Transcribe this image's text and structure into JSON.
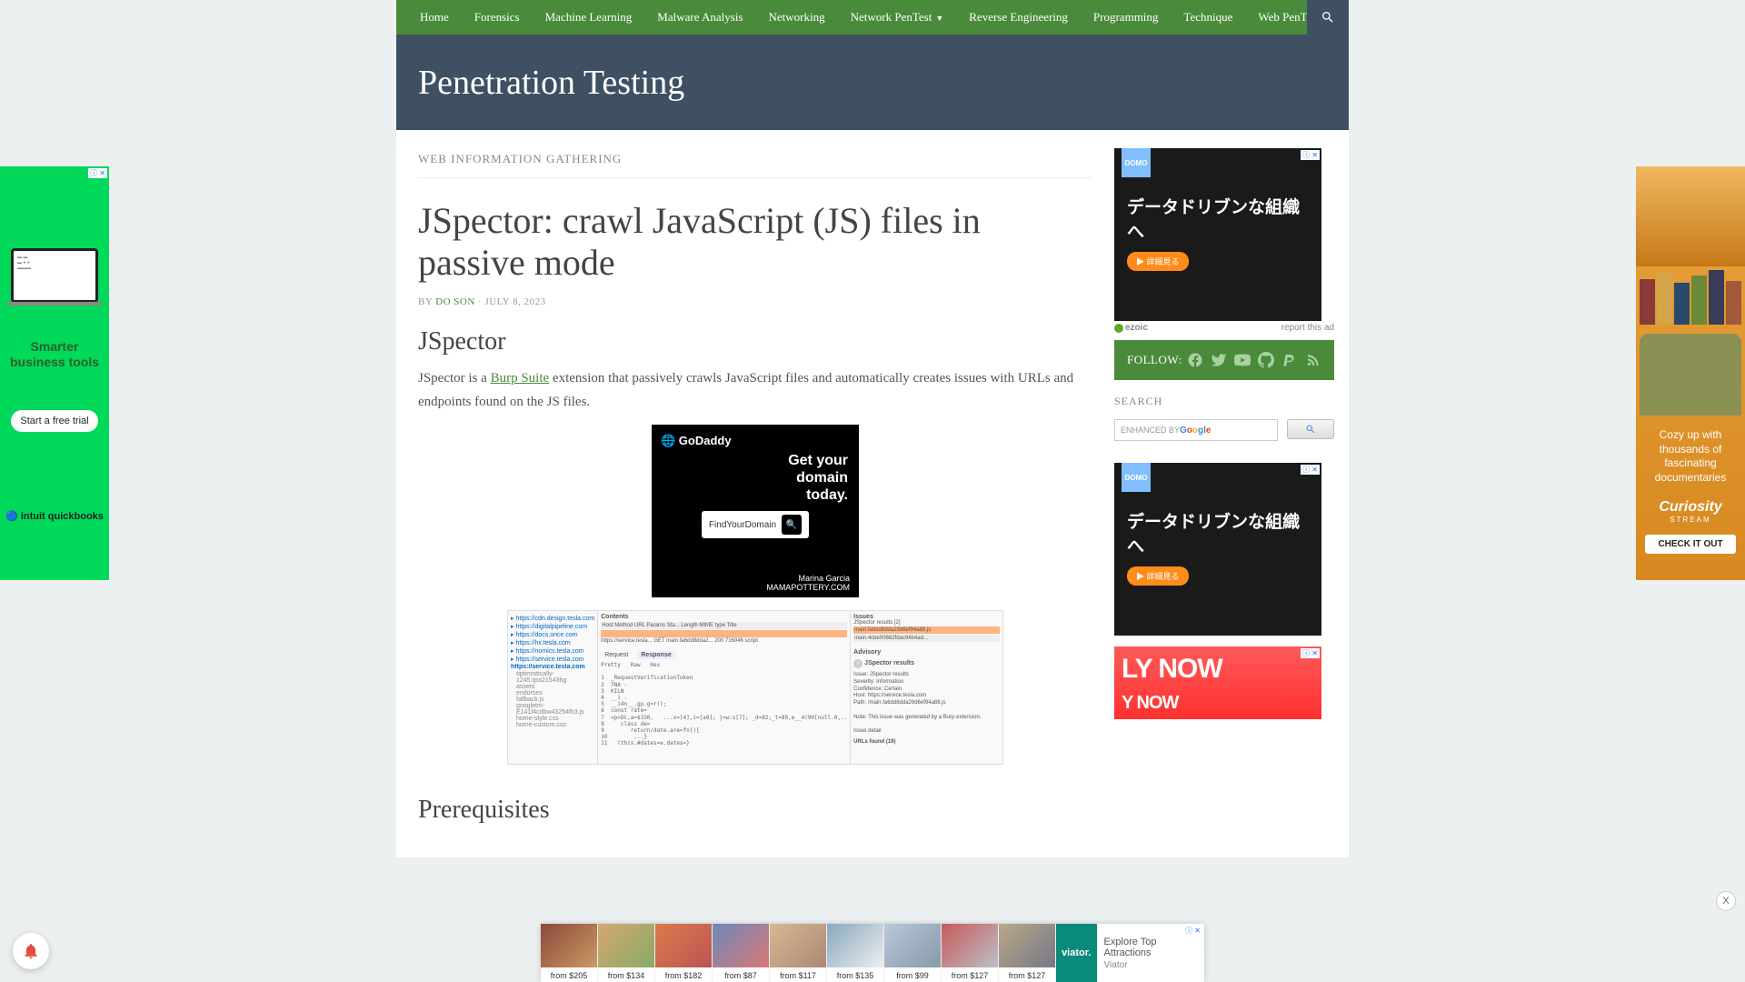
{
  "nav": {
    "items": [
      {
        "label": "Home",
        "dropdown": false
      },
      {
        "label": "Forensics",
        "dropdown": false
      },
      {
        "label": "Machine Learning",
        "dropdown": false
      },
      {
        "label": "Malware Analysis",
        "dropdown": false
      },
      {
        "label": "Networking",
        "dropdown": false
      },
      {
        "label": "Network PenTest",
        "dropdown": true
      },
      {
        "label": "Reverse Engineering",
        "dropdown": false
      },
      {
        "label": "Programming",
        "dropdown": false
      },
      {
        "label": "Technique",
        "dropdown": false
      },
      {
        "label": "Web PenTest",
        "dropdown": true
      }
    ]
  },
  "site_title": "Penetration Testing",
  "category": "WEB INFORMATION GATHERING",
  "article": {
    "title": "JSpector: crawl JavaScript (JS) files in passive mode",
    "by": "BY ",
    "author": "DO SON",
    "sep": " · ",
    "date": "JULY 8, 2023",
    "section": "JSpector",
    "p1_a": "JSpector is a ",
    "p1_link": "Burp Suite",
    "p1_b": " extension that passively crawls JavaScript files and automatically creates issues with URLs and endpoints found on the JS files.",
    "section2": "Prerequisites"
  },
  "ad_center": {
    "brand": "🌐 GoDaddy",
    "headline": "Get your domain today.",
    "placeholder": "FindYourDomain",
    "name1": "Marina Garcia",
    "name2": "MAMAPOTTERY.COM"
  },
  "screenshot": {
    "urls": [
      "https://cdn.design.tesla.com",
      "https://digitalpipeline.com",
      "https://docs.once.com",
      "https://hx.tesla.com",
      "https://nomics.tesla.com",
      "https://service.tesla.com"
    ],
    "last_url": "https://service.tesla.com",
    "tree": [
      "optimistically-1245.tjss21543hg",
      "assets",
      "endorses",
      "fallback.js",
      "googletm-E141f4cdbw43254fh3.js",
      "home-style.css",
      "home-custom.css"
    ],
    "contents_hdr": "Contents",
    "cols": "Host      Method    URL      Params   Sta...   Length   MIME type    Title",
    "row": "https://service.tesla... GET   main.fa6dd8dda2...        200   716046  script",
    "tabs": [
      "Request",
      "Response"
    ],
    "code": "Pretty   Raw   Hex\n\n1  _RequestVerificationToken\n2  TNA -\n3  KILN\n4  __i -\n5  __i4n__.gp.g=r();\n6  const rate=\n7  <p>DC,a=$330,   ...x=[4],i=[a9]; j=w:s[7]; _d=82;_t=89,e__4(90[null.0,..\n8     class de=\n9        return/date.are=fn(){\n10        ...}\n11   (this.#dates=e.dates=}",
    "issues_hdr": "Issues",
    "issue_rows": [
      "JSpector results [2]",
      "main.fa6dd8dda29d6ef94a88.js",
      "main.4cbe00662fdac94b4ad..."
    ],
    "advisory": "Advisory",
    "result_title": "JSpector results",
    "details": "Issue:         JSpector results\nSeverity:    Information\nConfidence: Certain\nHost:          https://service.tesla.com\nPath:          /main.fa6dd8dda29d6ef94a88.js\n\nNote: This issue was generated by a Burp extension.\n\nIssue detail",
    "urls_found": "URLs found (19)"
  },
  "ezoic": {
    "brand": "ezoic",
    "report": "report this ad"
  },
  "follow": {
    "label": "FOLLOW:"
  },
  "search": {
    "header": "SEARCH",
    "placeholder": "ENHANCED BY Google"
  },
  "ad_side": {
    "logo": "DOMO",
    "jp": "データドリブンな組織へ",
    "btn": "▶ 詳細見る",
    "adchoice": "ⓘ ✕"
  },
  "ad_red": {
    "text": "LY NOW",
    "text2": "Y NOW"
  },
  "ad_left": {
    "tagline1": "Smarter",
    "tagline2": "business tools",
    "cta": "Start a free trial",
    "brand": "🔵 intuit quickbooks"
  },
  "ad_right": {
    "txt": "Cozy up with thousands of fascinating documentaries",
    "brand": "Curiosity",
    "sub": "STREAM",
    "cta": "CHECK IT OUT"
  },
  "ad_bottom": {
    "thumbs": [
      {
        "price": "from $205"
      },
      {
        "price": "from $134"
      },
      {
        "price": "from $182"
      },
      {
        "price": "from $87"
      },
      {
        "price": "from $117"
      },
      {
        "price": "from $135"
      },
      {
        "price": "from $99"
      },
      {
        "price": "from $127"
      },
      {
        "price": "from $127"
      }
    ],
    "vlogo": "viator.",
    "t1": "Explore Top Attractions",
    "t2": "Viator",
    "adchoice": "ⓘ ✕"
  },
  "x_close": "X"
}
